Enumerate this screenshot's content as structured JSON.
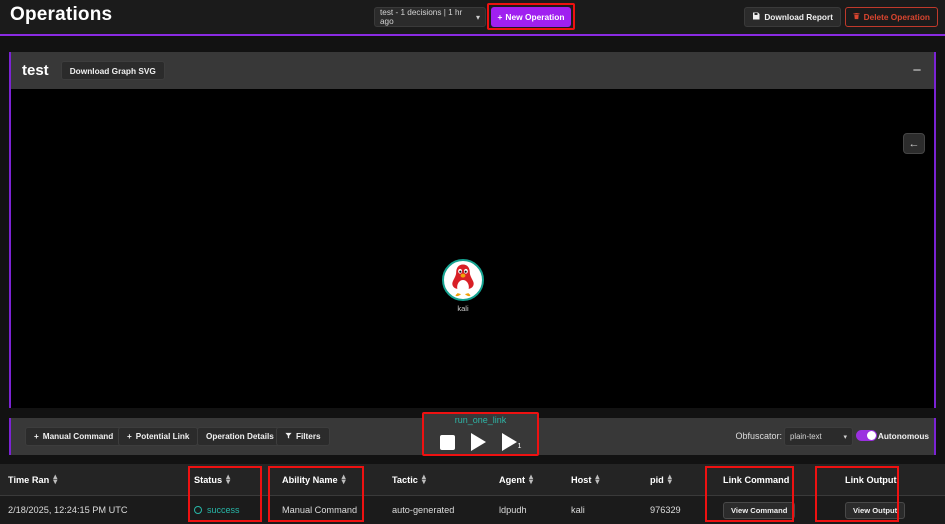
{
  "header": {
    "title": "Operations",
    "operation_select": {
      "value": "test - 1 decisions | 1 hr ago",
      "caret": "chevron-down-icon"
    },
    "new_operation_label": "New Operation",
    "new_operation_plus": "+",
    "download_report_label": "Download Report",
    "download_report_icon": "save-disk-icon",
    "delete_operation_label": "Delete Operation",
    "delete_operation_icon": "trash-icon",
    "accent_purple": "#a020f0",
    "danger_red": "#d9452f",
    "annotation_red": "#ee1111"
  },
  "graph_panel": {
    "title": "test",
    "download_graph_svg_label": "Download Graph SVG",
    "minimize_icon": "minimize-icon",
    "minimize_glyph": "−",
    "back_arrow_icon": "arrow-left-icon",
    "back_arrow_glyph": "←",
    "node": {
      "label": "kali",
      "icon": "linux-tux-penguin-icon",
      "ring_color": "#15a391"
    },
    "border_color": "#7b23d4",
    "canvas_bg": "#000000"
  },
  "controls": {
    "manual_command": "Manual Command",
    "potential_link": "Potential Link",
    "operation_details": "Operation Details",
    "filters": "Filters",
    "filters_icon": "funnel-icon",
    "plus_glyph": "+",
    "player": {
      "label": "run_one_link",
      "stop_icon": "stop-icon",
      "play_icon": "play-icon",
      "step_icon": "step-forward-icon",
      "step_badge": "1",
      "label_color": "#2fb5a6"
    },
    "obfuscator_label": "Obfuscator:",
    "obfuscator_value": "plain-text",
    "obfuscator_caret": "chevron-down-icon",
    "autonomous_label": "Autonomous",
    "autonomous_on": true,
    "toggle_color": "#9b30e0"
  },
  "table": {
    "columns": [
      {
        "key": "time_ran",
        "label": "Time Ran",
        "sortable": true
      },
      {
        "key": "status",
        "label": "Status",
        "sortable": true
      },
      {
        "key": "ability_name",
        "label": "Ability Name",
        "sortable": true
      },
      {
        "key": "tactic",
        "label": "Tactic",
        "sortable": true
      },
      {
        "key": "agent",
        "label": "Agent",
        "sortable": true
      },
      {
        "key": "host",
        "label": "Host",
        "sortable": true
      },
      {
        "key": "pid",
        "label": "pid",
        "sortable": true
      },
      {
        "key": "link_command",
        "label": "Link Command",
        "sortable": false
      },
      {
        "key": "link_output",
        "label": "Link Output",
        "sortable": false
      }
    ],
    "rows": [
      {
        "time_ran": "2/18/2025, 12:24:15 PM UTC",
        "status": "success",
        "status_color": "#27b7a8",
        "ability_name": "Manual Command",
        "tactic": "auto-generated",
        "agent": "ldpudh",
        "host": "kali",
        "pid": "976329",
        "link_command": "View Command",
        "link_output": "View Output"
      }
    ]
  }
}
